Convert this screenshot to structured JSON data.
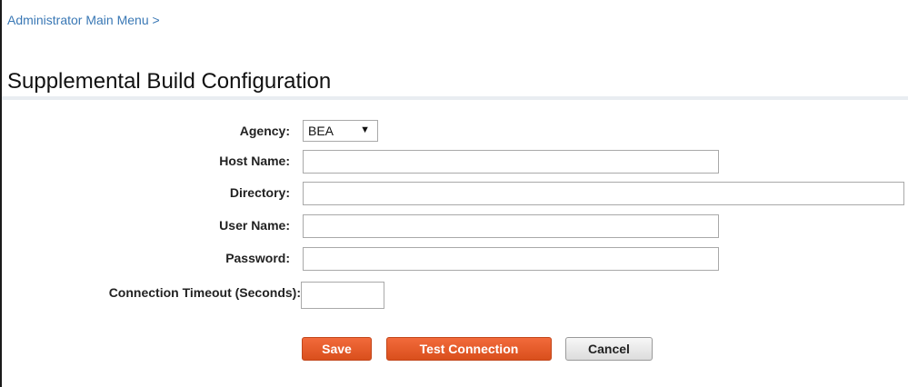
{
  "breadcrumb": "Administrator Main Menu >",
  "page_title": "Supplemental Build Configuration",
  "form": {
    "agency_label": "Agency:",
    "agency_selected": "BEA",
    "host_name_label": "Host Name:",
    "host_name_value": "",
    "directory_label": "Directory:",
    "directory_value": "",
    "user_name_label": "User Name:",
    "user_name_value": "",
    "password_label": "Password:",
    "password_value": "",
    "timeout_label": "Connection Timeout (Seconds):",
    "timeout_value": ""
  },
  "buttons": {
    "save": "Save",
    "test_connection": "Test Connection",
    "cancel": "Cancel"
  },
  "colors": {
    "link": "#3a78b5",
    "primary_button": "#e05a28",
    "secondary_button": "#e6e6e6",
    "title_rule": "#e9edf1"
  },
  "icons": {
    "dropdown": "triangle-down"
  }
}
